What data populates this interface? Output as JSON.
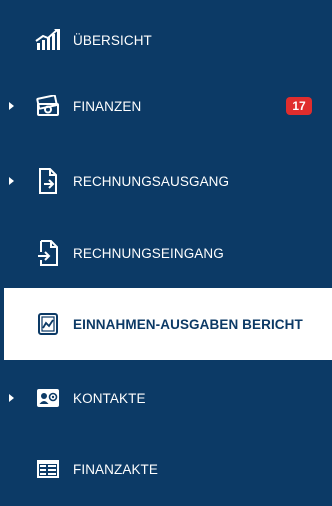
{
  "colors": {
    "sidebar_bg": "#0c3a66",
    "active_bg": "#ffffff",
    "badge_bg": "#e02d2d"
  },
  "nav": {
    "items": [
      {
        "label": "ÜBERSICHT",
        "icon": "bar-chart-icon",
        "has_submenu": false
      },
      {
        "label": "FINANZEN",
        "icon": "money-icon",
        "has_submenu": true,
        "badge": "17"
      },
      {
        "label": "RECHNUNGSAUSGANG",
        "icon": "outgoing-invoice-icon",
        "has_submenu": true
      },
      {
        "label": "RECHNUNGSEINGANG",
        "icon": "incoming-invoice-icon",
        "has_submenu": false
      },
      {
        "label": "EINNAHMEN-AUSGABEN BERICHT",
        "icon": "report-chart-icon",
        "has_submenu": false,
        "active": true
      },
      {
        "label": "KONTAKTE",
        "icon": "contact-card-icon",
        "has_submenu": true
      },
      {
        "label": "FINANZAKTE",
        "icon": "finance-file-icon",
        "has_submenu": false
      }
    ]
  }
}
